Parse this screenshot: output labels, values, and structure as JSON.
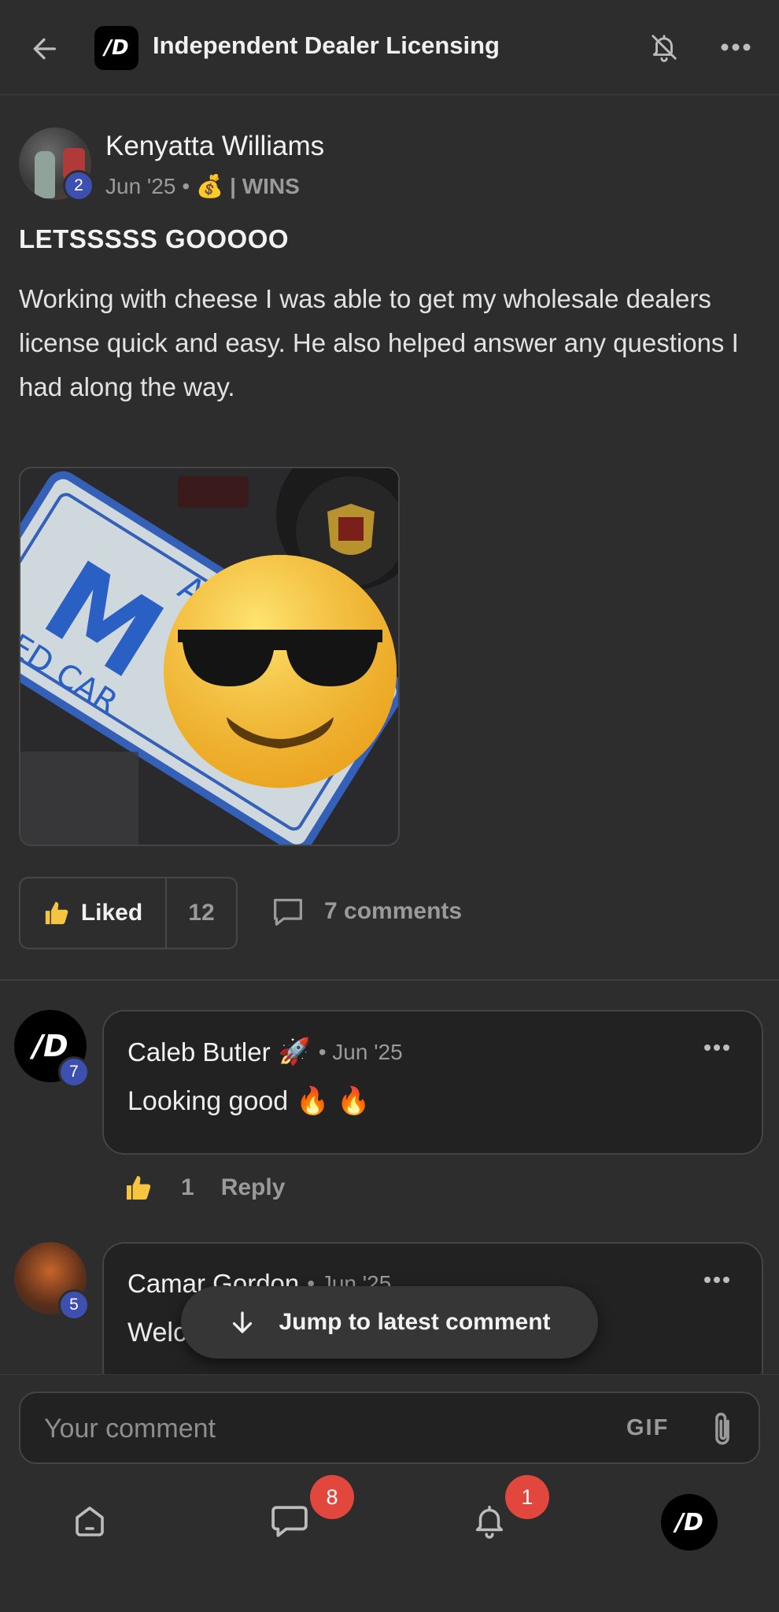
{
  "header": {
    "title": "Independent Dealer Licensing",
    "back_icon": "arrow-left-icon",
    "mute_icon": "bell-off-icon",
    "more_icon": "more-horizontal-icon",
    "logo_text": "/D"
  },
  "post": {
    "author": "Kenyatta Williams",
    "author_level": "2",
    "date": "Jun '25",
    "separator": "•",
    "category_emoji": "💰",
    "category": "| WINS",
    "title": "LETSSSSS GOOOOO",
    "body": "Working with cheese I was able to get my wholesale dealers license quick and easy. He also helped answer any questions I had along the way.",
    "like_label": "Liked",
    "like_count": "12",
    "comments_label": "7 comments"
  },
  "comments": [
    {
      "author": "Caleb Butler",
      "author_emoji": "🚀",
      "date": "• Jun '25",
      "level": "7",
      "text": "Looking good",
      "text_emoji": "🔥 🔥",
      "like_count": "1",
      "reply_label": "Reply"
    },
    {
      "author": "Camar Gordon",
      "date": "• Jun '25",
      "level": "5",
      "text": "Welc"
    }
  ],
  "jump_button": {
    "label": "Jump to latest comment"
  },
  "composer": {
    "placeholder": "Your comment",
    "gif_label": "GIF"
  },
  "bottom_nav": {
    "chat_badge": "8",
    "notifications_badge": "1"
  },
  "colors": {
    "background": "#2d2d2d",
    "badge_blue": "#3d50b0",
    "badge_red": "#e2473d",
    "like_yellow": "#f5c542"
  }
}
